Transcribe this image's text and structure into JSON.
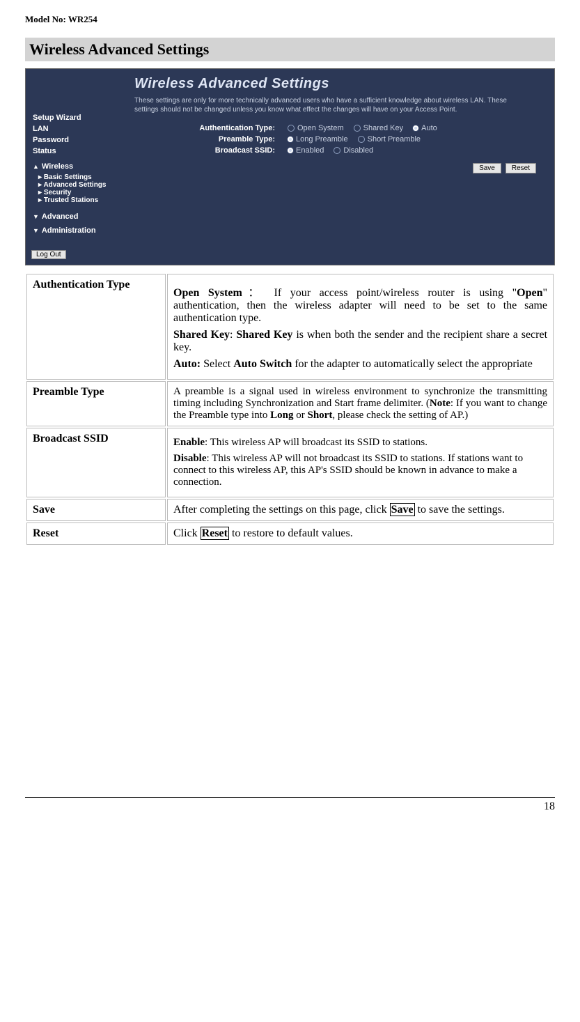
{
  "page_header": "Model No: WR254",
  "page_number": "18",
  "section_title": "Wireless Advanced Settings",
  "screenshot": {
    "title": "Wireless Advanced Settings",
    "description": "These settings are only for more technically advanced users who have a sufficient knowledge about wireless LAN. These settings should not be changed unless you know what effect the changes will have on your Access Point.",
    "sidebar": {
      "setup_wizard": "Setup Wizard",
      "lan": "LAN",
      "password": "Password",
      "status": "Status",
      "wireless": "Wireless",
      "basic_settings": "Basic Settings",
      "advanced_settings": "Advanced Settings",
      "security": "Security",
      "trusted_stations": "Trusted Stations",
      "advanced": "Advanced",
      "administration": "Administration",
      "logout": "Log Out"
    },
    "form": {
      "auth_label": "Authentication Type:",
      "auth_opts": {
        "open": "Open System",
        "shared": "Shared Key",
        "auto": "Auto"
      },
      "preamble_label": "Preamble Type:",
      "preamble_opts": {
        "long": "Long Preamble",
        "short": "Short Preamble"
      },
      "ssid_label": "Broadcast SSID:",
      "ssid_opts": {
        "enabled": "Enabled",
        "disabled": "Disabled"
      },
      "save": "Save",
      "reset": "Reset"
    }
  },
  "table": {
    "auth": {
      "key": "Authentication Type",
      "p1a": "Open System",
      "p1b": "： If your access point/wireless router is using \"",
      "p1c": "Open",
      "p1d": "\" authentication, then the wireless adapter will need to be set to the same authentication type.",
      "p2a": "Shared Key",
      "p2b": ": ",
      "p2c": "Shared Key",
      "p2d": " is when both the sender and the recipient share a secret key.",
      "p3a": "Auto:",
      "p3b": " Select ",
      "p3c": "Auto Switch",
      "p3d": " for the adapter to automatically select the appropriate"
    },
    "preamble": {
      "key": "Preamble Type",
      "p1a": "A preamble is a signal used in wireless environment to synchronize the transmitting timing including Synchronization and Start frame delimiter. (",
      "p1b": "Note",
      "p1c": ": If you want to change the Preamble type into ",
      "p1d": "Long",
      "p1e": " or ",
      "p1f": "Short",
      "p1g": ", please check the setting of AP.)"
    },
    "ssid": {
      "key": "Broadcast SSID",
      "p1a": "Enable",
      "p1b": ": This wireless AP will broadcast its SSID to stations.",
      "p2a": "Disable",
      "p2b": ": This wireless AP will not broadcast its SSID to stations. If stations want to connect to this wireless AP, this AP's SSID should be known in advance to make a connection."
    },
    "save": {
      "key": "Save",
      "p1a": "After completing the settings on this page, click ",
      "p1b": "Save",
      "p1c": " to save the settings."
    },
    "reset": {
      "key": "Reset",
      "p1a": "Click ",
      "p1b": "Reset",
      "p1c": " to restore to default values."
    }
  }
}
